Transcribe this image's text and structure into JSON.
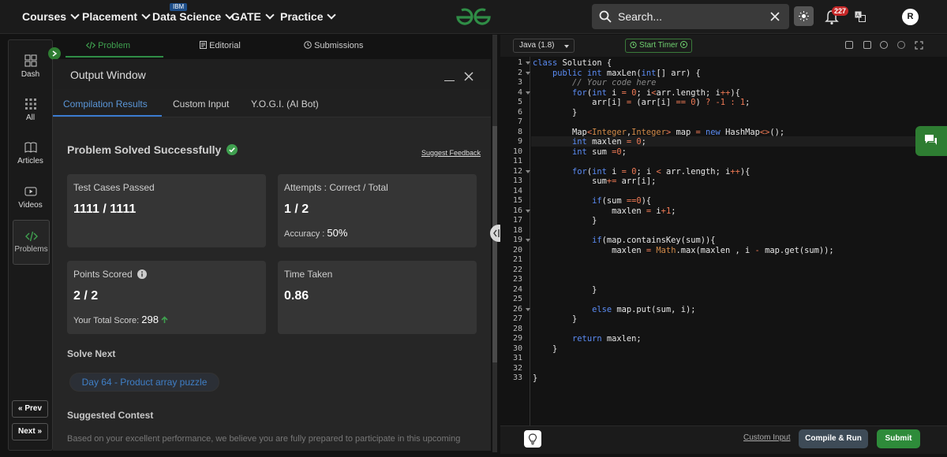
{
  "nav": {
    "items": [
      {
        "label": "Courses"
      },
      {
        "label": "Placement"
      },
      {
        "label": "Data Science"
      },
      {
        "label": "GATE"
      },
      {
        "label": "Practice"
      }
    ],
    "ibm_tag": "IBM",
    "search_placeholder": "Search...",
    "notifications_count": "227",
    "avatar_initial": "R",
    "logo_color": "#2f8d46"
  },
  "rail": {
    "items": [
      {
        "label": "Dash",
        "icon": "dashboard-icon"
      },
      {
        "label": "All",
        "icon": "grid-icon"
      },
      {
        "label": "Articles",
        "icon": "book-icon"
      },
      {
        "label": "Videos",
        "icon": "play-icon"
      },
      {
        "label": "Problems",
        "icon": "code-icon"
      }
    ],
    "prev_label": "« Prev",
    "next_label": "Next »"
  },
  "problem_tabs": [
    {
      "label": "Problem",
      "icon": "code-icon"
    },
    {
      "label": "Editorial",
      "icon": "document-icon"
    },
    {
      "label": "Submissions",
      "icon": "clock-icon"
    }
  ],
  "output": {
    "title": "Output Window",
    "tabs": [
      "Compilation Results",
      "Custom Input",
      "Y.O.G.I. (AI Bot)"
    ],
    "status": "Problem Solved Successfully",
    "suggest_feedback": "Suggest Feedback",
    "cards": {
      "tests": {
        "label": "Test Cases Passed",
        "value": "1111 / 1111"
      },
      "attempts": {
        "label": "Attempts : Correct / Total",
        "value": "1 / 2",
        "accuracy_label": "Accuracy :",
        "accuracy_value": "50%"
      },
      "points": {
        "label": "Points Scored",
        "value": "2 / 2",
        "total_label": "Your Total Score:",
        "total_value": "298"
      },
      "time": {
        "label": "Time Taken",
        "value": "0.86"
      }
    },
    "solve_next_heading": "Solve Next",
    "solve_next_item": "Day 64 - Product array puzzle",
    "contest_heading": "Suggested Contest",
    "contest_text": "Based on your excellent performance, we believe you are fully prepared to participate in this upcoming"
  },
  "editor": {
    "language": "Java (1.8)",
    "timer_label": "Start Timer",
    "line_numbers": [
      "1",
      "2",
      "3",
      "4",
      "5",
      "6",
      "7",
      "8",
      "9",
      "10",
      "11",
      "12",
      "13",
      "14",
      "15",
      "16",
      "17",
      "18",
      "19",
      "20",
      "21",
      "22",
      "23",
      "24",
      "25",
      "26",
      "27",
      "28",
      "29",
      "30",
      "31",
      "32",
      "33"
    ],
    "custom_input": "Custom Input",
    "run_label": "Compile & Run",
    "submit_label": "Submit"
  }
}
